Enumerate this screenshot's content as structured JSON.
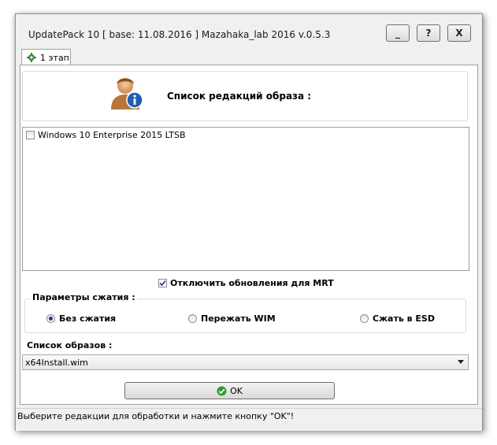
{
  "window": {
    "title": "UpdatePack 10 [ base: 11.08.2016 ] Mazahaka_lab 2016 v.0.5.3",
    "buttons": {
      "minimize": "_",
      "help": "?",
      "close": "X"
    }
  },
  "tabs": [
    {
      "label": "1 этап",
      "icon": "settings-icon",
      "selected": true
    }
  ],
  "header": {
    "title": "Список редакций образа :",
    "icon": "user-info-icon"
  },
  "editions": [
    {
      "label": "Windows 10 Enterprise 2015 LTSB",
      "checked": false
    }
  ],
  "mrt": {
    "label": "Отключить обновления  для MRT",
    "checked": true
  },
  "compression": {
    "title": "Параметры сжатия :",
    "options": [
      {
        "label": "Без сжатия",
        "selected": true
      },
      {
        "label": "Пережать  WIM",
        "selected": false
      },
      {
        "label": "Сжать в ESD",
        "selected": false
      }
    ]
  },
  "images": {
    "label": "Список образов :",
    "selected": "x64Install.wim"
  },
  "ok_button": {
    "label": "OK",
    "icon": "green-check-icon"
  },
  "status": {
    "text": "Выберите  редакции для обработки и нажмите кнопку \"OK\"!"
  },
  "colors": {
    "window_bg": "#f0f0f0",
    "panel_bg": "#ffffff",
    "radio_dot": "#1a3d7c",
    "check_green": "#2f9e2f"
  }
}
